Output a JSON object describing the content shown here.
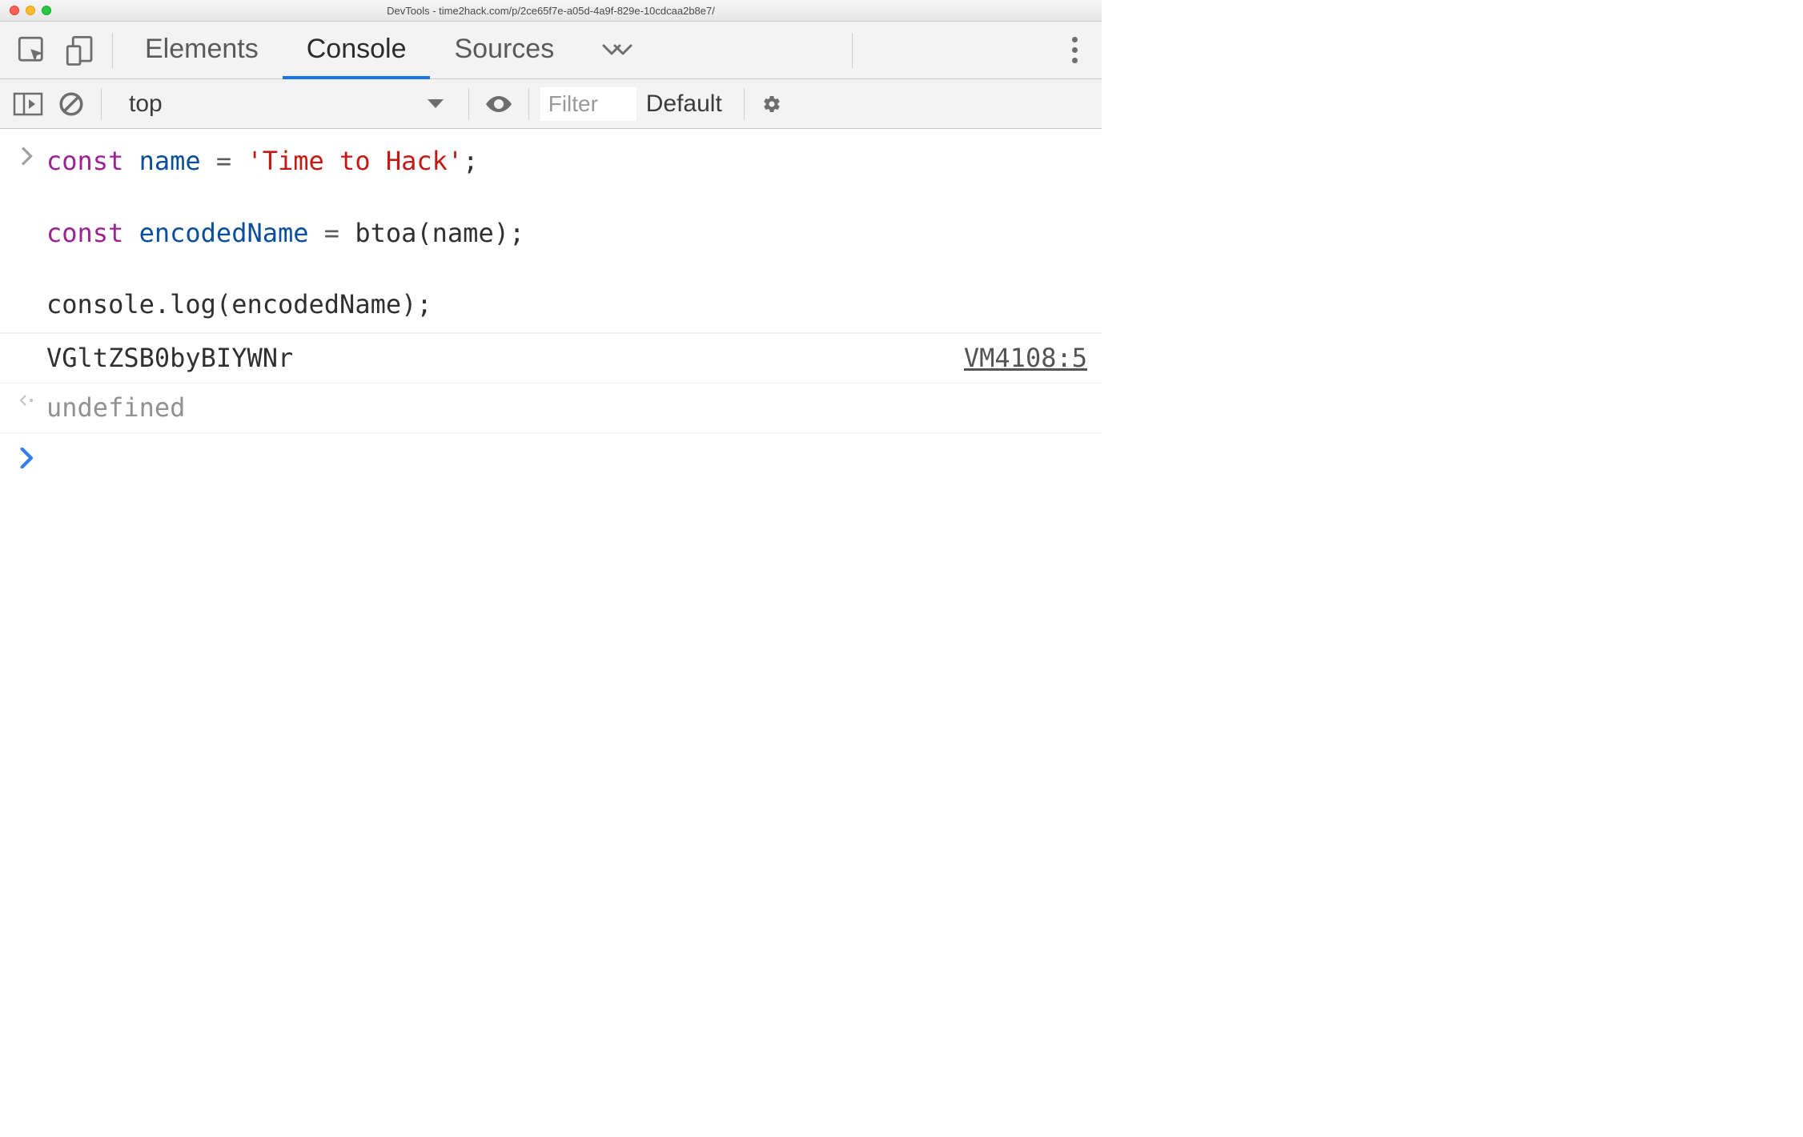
{
  "window": {
    "title": "DevTools - time2hack.com/p/2ce65f7e-a05d-4a9f-829e-10cdcaa2b8e7/"
  },
  "tabs": {
    "elements": "Elements",
    "console": "Console",
    "sources": "Sources"
  },
  "filterbar": {
    "context": "top",
    "filter_placeholder": "Filter",
    "levels": "Default"
  },
  "code": {
    "l1": {
      "kw": "const",
      "id": "name",
      "eq": " = ",
      "str": "'Time to Hack'",
      "semi": ";"
    },
    "l2": "",
    "l3": {
      "kw": "const",
      "id": "encodedName",
      "eq": " = ",
      "call": "btoa(name);"
    },
    "l4": "",
    "l5": "console.log(encodedName);"
  },
  "output": {
    "value": "VGltZSB0byBIYWNr",
    "source": "VM4108:5"
  },
  "return": {
    "value": "undefined"
  }
}
